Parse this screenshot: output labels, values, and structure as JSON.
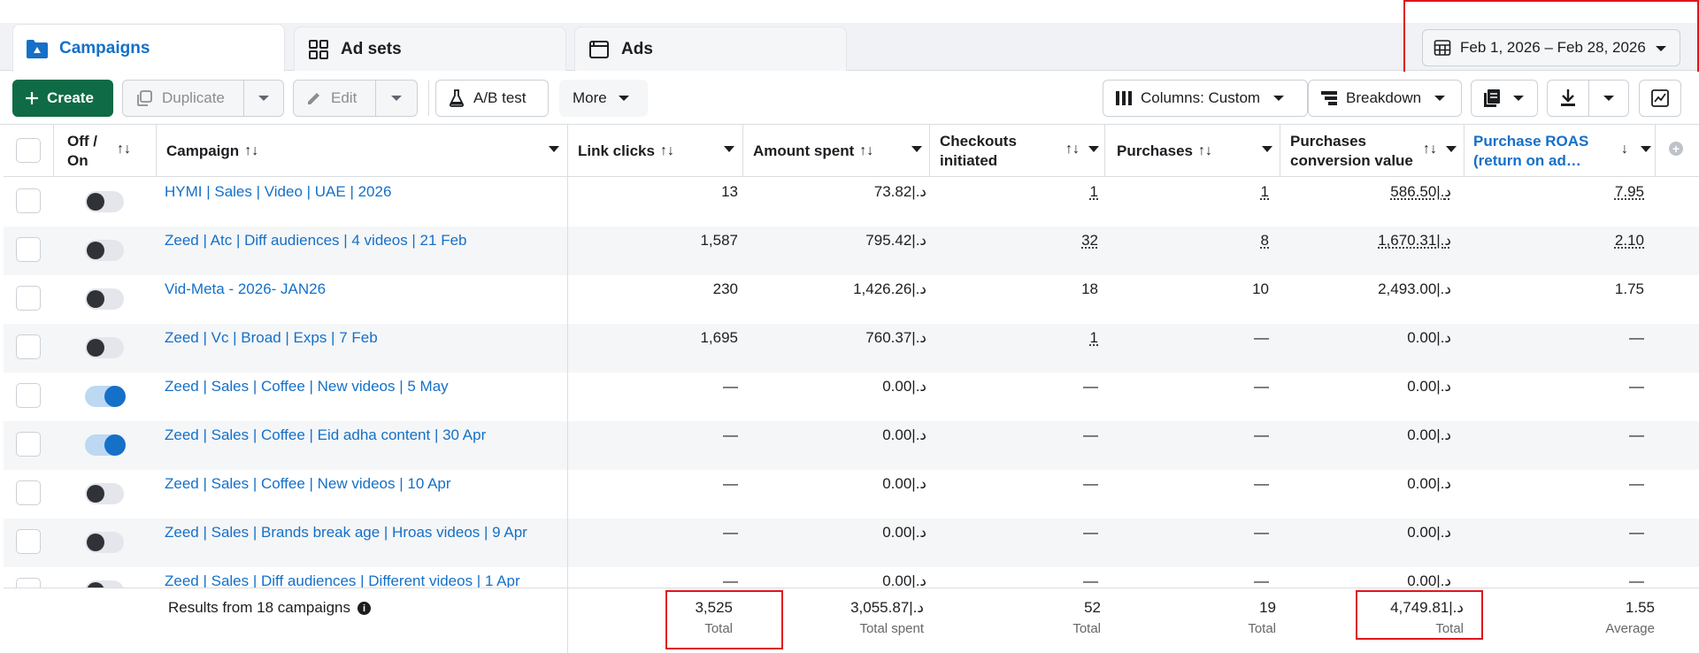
{
  "tabs": [
    {
      "label": "Campaigns",
      "icon": "folder-icon"
    },
    {
      "label": "Ad sets",
      "icon": "grid-icon"
    },
    {
      "label": "Ads",
      "icon": "ad-window-icon"
    }
  ],
  "date_range": {
    "label": "Feb 1, 2026 – Feb 28, 2026"
  },
  "toolbar": {
    "create_label": "Create",
    "duplicate_label": "Duplicate",
    "edit_label": "Edit",
    "abtest_label": "A/B test",
    "more_label": "More",
    "columns_label": "Columns: Custom",
    "breakdown_label": "Breakdown"
  },
  "columns": {
    "offon_1": "Off /",
    "offon_2": "On",
    "campaign": "Campaign",
    "link_clicks": "Link clicks",
    "amount_spent": "Amount spent",
    "checkouts_1": "Checkouts",
    "checkouts_2": "initiated",
    "purchases": "Purchases",
    "pcv_1": "Purchases",
    "pcv_2": "conversion value",
    "roas_1": "Purchase ROAS",
    "roas_2": "(return on ad…"
  },
  "rows": [
    {
      "name": "HYMI | Sales | Video | UAE | 2026",
      "on": false,
      "clicks": "13",
      "spent": "73.82|.د",
      "checkouts": "1",
      "purchases": "1",
      "value": "586.50|.د",
      "roas": "7.95"
    },
    {
      "name": "Zeed | Atc | Diff audiences | 4 videos | 21 Feb",
      "on": false,
      "clicks": "1,587",
      "spent": "795.42|.د",
      "checkouts": "32",
      "purchases": "8",
      "value": "1,670.31|.د",
      "roas": "2.10"
    },
    {
      "name": "Vid-Meta - 2026- JAN26",
      "on": false,
      "clicks": "230",
      "spent": "1,426.26|.د",
      "checkouts": "18",
      "purchases": "10",
      "value": "2,493.00|.د",
      "roas": "1.75"
    },
    {
      "name": "Zeed | Vc | Broad | Exps | 7 Feb",
      "on": false,
      "clicks": "1,695",
      "spent": "760.37|.د",
      "checkouts": "1",
      "purchases": "—",
      "value": "0.00|.د",
      "roas": "—"
    },
    {
      "name": "Zeed | Sales | Coffee | New videos | 5 May",
      "on": true,
      "clicks": "—",
      "spent": "0.00|.د",
      "checkouts": "—",
      "purchases": "—",
      "value": "0.00|.د",
      "roas": "—"
    },
    {
      "name": "Zeed | Sales | Coffee | Eid adha content | 30 Apr",
      "on": true,
      "clicks": "—",
      "spent": "0.00|.د",
      "checkouts": "—",
      "purchases": "—",
      "value": "0.00|.د",
      "roas": "—"
    },
    {
      "name": "Zeed | Sales | Coffee | New videos | 10 Apr",
      "on": false,
      "clicks": "—",
      "spent": "0.00|.د",
      "checkouts": "—",
      "purchases": "—",
      "value": "0.00|.د",
      "roas": "—"
    },
    {
      "name": "Zeed | Sales | Brands break age | Hroas videos | 9 Apr",
      "on": false,
      "clicks": "—",
      "spent": "0.00|.د",
      "checkouts": "—",
      "purchases": "—",
      "value": "0.00|.د",
      "roas": "—"
    },
    {
      "name": "Zeed | Sales | Diff audiences | Different videos | 1 Apr",
      "on": false,
      "clicks": "—",
      "spent": "0.00|.د",
      "checkouts": "—",
      "purchases": "—",
      "value": "0.00|.د",
      "roas": "—"
    }
  ],
  "totals": {
    "results_label": "Results from 18 campaigns",
    "clicks": "3,525",
    "clicks_label": "Total",
    "spent": "3,055.87|.د",
    "spent_label": "Total spent",
    "checkouts": "52",
    "checkouts_label": "Total",
    "purchases": "19",
    "purchases_label": "Total",
    "value": "4,749.81|.د",
    "value_label": "Total",
    "roas": "1.55",
    "roas_label": "Average"
  },
  "colors": {
    "accent": "#1570c8",
    "create": "#0f6b45",
    "highlight": "#e0141e"
  }
}
